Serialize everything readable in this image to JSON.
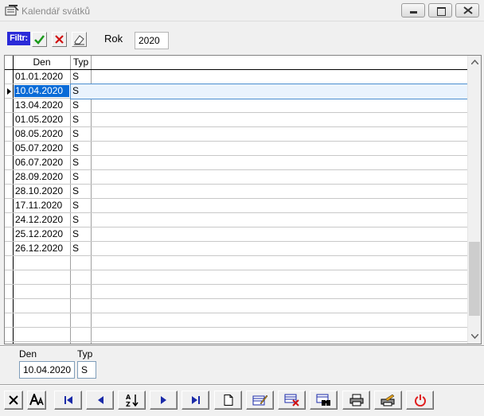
{
  "window": {
    "title": "Kalendář svátků"
  },
  "filter": {
    "label": "Filtr:",
    "rok_label": "Rok",
    "rok_value": "2020"
  },
  "grid": {
    "columns": [
      "Den",
      "Typ"
    ],
    "rows": [
      {
        "den": "01.01.2020",
        "typ": "S"
      },
      {
        "den": "10.04.2020",
        "typ": "S"
      },
      {
        "den": "13.04.2020",
        "typ": "S"
      },
      {
        "den": "01.05.2020",
        "typ": "S"
      },
      {
        "den": "08.05.2020",
        "typ": "S"
      },
      {
        "den": "05.07.2020",
        "typ": "S"
      },
      {
        "den": "06.07.2020",
        "typ": "S"
      },
      {
        "den": "28.09.2020",
        "typ": "S"
      },
      {
        "den": "28.10.2020",
        "typ": "S"
      },
      {
        "den": "17.11.2020",
        "typ": "S"
      },
      {
        "den": "24.12.2020",
        "typ": "S"
      },
      {
        "den": "25.12.2020",
        "typ": "S"
      },
      {
        "den": "26.12.2020",
        "typ": "S"
      }
    ],
    "selected_index": 1
  },
  "detail": {
    "den_label": "Den",
    "typ_label": "Typ",
    "den_value": "10.04.2020",
    "typ_value": "S"
  },
  "toolbar": {
    "buttons": [
      {
        "name": "cancel-icon"
      },
      {
        "name": "font-icon"
      },
      {
        "name": "first-record-icon"
      },
      {
        "name": "prev-record-icon"
      },
      {
        "name": "sort-az-icon"
      },
      {
        "name": "next-record-icon"
      },
      {
        "name": "last-record-icon"
      },
      {
        "name": "new-record-icon"
      },
      {
        "name": "edit-record-icon"
      },
      {
        "name": "delete-record-icon"
      },
      {
        "name": "find-record-icon"
      },
      {
        "name": "print-icon"
      },
      {
        "name": "print-settings-icon"
      },
      {
        "name": "power-icon"
      }
    ]
  },
  "colors": {
    "filter_bg": "#2a2ad8",
    "selection": "#0a6bd7",
    "power": "#e02020"
  }
}
